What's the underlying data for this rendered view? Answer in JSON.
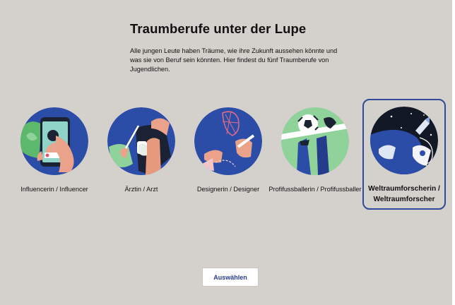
{
  "page": {
    "title": "Traumberufe unter der Lupe",
    "intro": "Alle jungen Leute haben Träume, wie ihre Zukunft aussehen könnte und was sie von Beruf sein könnten. Hier findest du fünf Traumberufe von Jugendlichen."
  },
  "options": [
    {
      "label": "Influencerin / Influencer",
      "icon": "influencer-illustration",
      "selected": false
    },
    {
      "label": "Ärztin / Arzt",
      "icon": "doctor-illustration",
      "selected": false
    },
    {
      "label": "Designerin / Designer",
      "icon": "designer-illustration",
      "selected": false
    },
    {
      "label": "Profifussballerin / Profifussballer",
      "icon": "football-player-illustration",
      "selected": false
    },
    {
      "label": "Weltraumforscherin / Weltraumforscher",
      "icon": "astronaut-illustration",
      "selected": true
    }
  ],
  "actions": {
    "select_label": "Auswählen"
  },
  "colors": {
    "background": "#d4d0cc",
    "circle_blue": "#2b4da8",
    "selection_border": "#2f4b9a",
    "button_text": "#253c8c"
  }
}
